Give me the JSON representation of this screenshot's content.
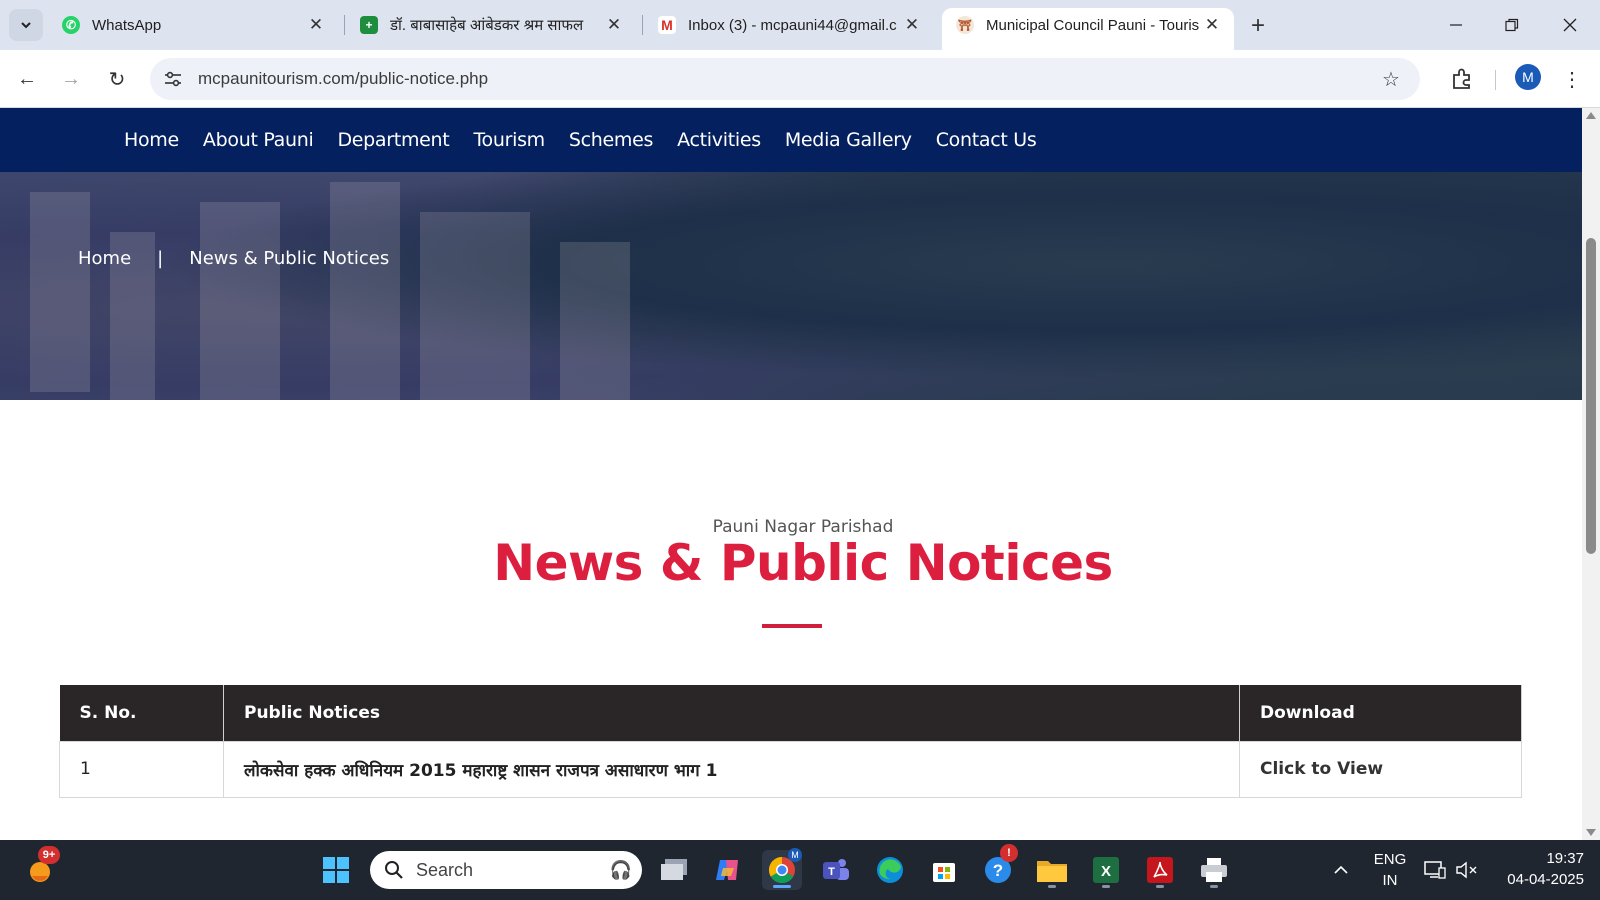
{
  "browser": {
    "tabs": [
      {
        "title": "WhatsApp",
        "icon": "whatsapp-icon"
      },
      {
        "title": "डॉ. बाबासाहेब आंबेडकर श्रम साफल",
        "icon": "sheets-icon"
      },
      {
        "title": "Inbox (3) - mcpauni44@gmail.c",
        "icon": "gmail-icon"
      },
      {
        "title": "Municipal Council Pauni - Touris",
        "icon": "council-emblem-icon",
        "active": true
      }
    ],
    "url": "mcpaunitourism.com/public-notice.php",
    "profile_initial": "M"
  },
  "site": {
    "nav": [
      "Home",
      "About Pauni",
      "Department",
      "Tourism",
      "Schemes",
      "Activities",
      "Media Gallery",
      "Contact Us"
    ],
    "breadcrumb": {
      "home": "Home",
      "separator": "|",
      "current": "News & Public Notices"
    },
    "section_subtitle": "Pauni Nagar Parishad",
    "section_title": "News & Public Notices",
    "table": {
      "headers": [
        "S. No.",
        "Public Notices",
        "Download"
      ],
      "rows": [
        {
          "sno": "1",
          "notice": "लोकसेवा हक्क अधिनियम 2015 महाराष्ट्र शासन राजपत्र असाधारण भाग 1",
          "download": "Click to View"
        }
      ]
    },
    "colors": {
      "nav_bg": "#04205f",
      "title_red": "#dc1e3f",
      "table_header_bg": "#2a2627"
    }
  },
  "taskbar": {
    "search_label": "Search",
    "notification_badge": "9+",
    "alert_badge": "!",
    "language": {
      "line1": "ENG",
      "line2": "IN"
    },
    "time": "19:37",
    "date": "04-04-2025"
  }
}
